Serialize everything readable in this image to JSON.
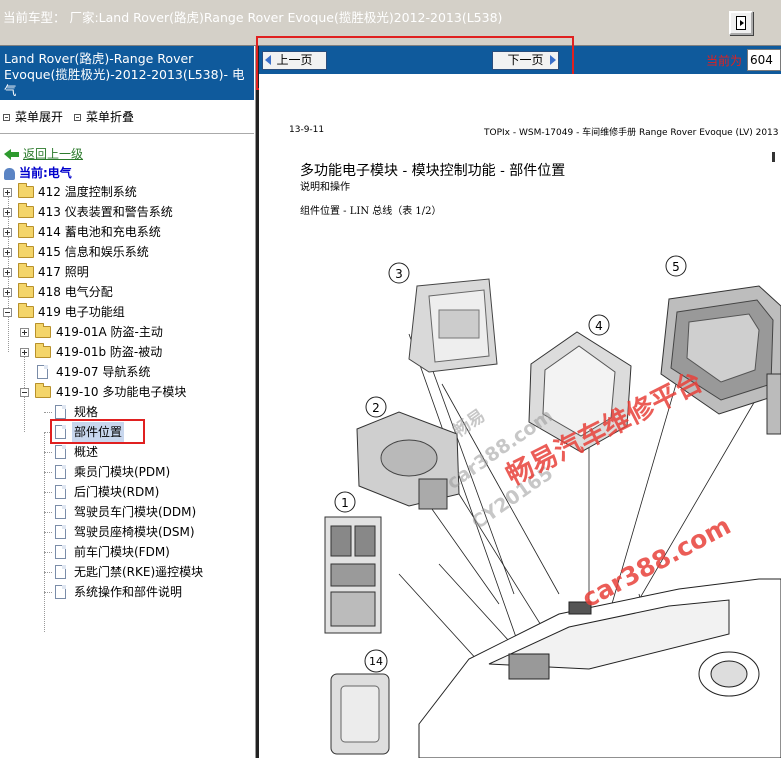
{
  "topbar": {
    "title": "当前车型：  厂家:Land Rover(路虎)Range Rover Evoque(揽胜极光)2012-2013(L538)"
  },
  "sidebar": {
    "model_title": "Land Rover(路虎)-Range Rover Evoque(揽胜极光)-2012-2013(L538)- 电气",
    "expand_label": "菜单展开",
    "collapse_label": "菜单折叠",
    "back_label": "返回上一级",
    "current_label": "当前:电气",
    "tree": [
      {
        "label": "412 温度控制系统",
        "type": "folder"
      },
      {
        "label": "413 仪表装置和警告系统",
        "type": "folder"
      },
      {
        "label": "414 蓄电池和充电系统",
        "type": "folder"
      },
      {
        "label": "415 信息和娱乐系统",
        "type": "folder"
      },
      {
        "label": "417 照明",
        "type": "folder"
      },
      {
        "label": "418 电气分配",
        "type": "folder"
      },
      {
        "label": "419 电子功能组",
        "type": "folder-open"
      },
      {
        "label": "419-01A 防盗-主动",
        "type": "folder"
      },
      {
        "label": "419-01b 防盗-被动",
        "type": "folder"
      },
      {
        "label": "419-07 导航系统",
        "type": "page"
      },
      {
        "label": "419-10 多功能电子模块",
        "type": "folder-open"
      },
      {
        "label": "规格",
        "type": "page"
      },
      {
        "label": "部件位置",
        "type": "page",
        "selected": true
      },
      {
        "label": "概述",
        "type": "page"
      },
      {
        "label": "乘员门模块(PDM)",
        "type": "page"
      },
      {
        "label": "后门模块(RDM)",
        "type": "page"
      },
      {
        "label": "驾驶员车门模块(DDM)",
        "type": "page"
      },
      {
        "label": "驾驶员座椅模块(DSM)",
        "type": "page"
      },
      {
        "label": "前车门模块(FDM)",
        "type": "page"
      },
      {
        "label": "无匙门禁(RKE)遥控模块",
        "type": "page"
      },
      {
        "label": "系统操作和部件说明",
        "type": "page"
      }
    ]
  },
  "nav": {
    "prev_label": "上一页",
    "next_label": "下一页",
    "page_label": "当前为",
    "page_value": "604"
  },
  "document": {
    "header_left": "13-9-11",
    "header_right": "TOPIx - WSM-17049 - 车间维修手册 Range Rover Evoque (LV) 2013",
    "title": "多功能电子模块 - 模块控制功能  - 部件位置",
    "subtitle": "说明和操作",
    "section": "组件位置 - LIN 总线（表 1/2）",
    "callouts": [
      "1",
      "2",
      "3",
      "4",
      "5",
      "14"
    ]
  },
  "watermarks": {
    "red_text": "畅易汽车维修平台",
    "domain": "car388.com",
    "grey_1": "畅易",
    "grey_2": "car388.com",
    "grey_3": "CY20165"
  },
  "colors": {
    "accent_blue": "#0f5a9c",
    "highlight_red": "#e02020",
    "watermark_red": "#e8413a"
  }
}
